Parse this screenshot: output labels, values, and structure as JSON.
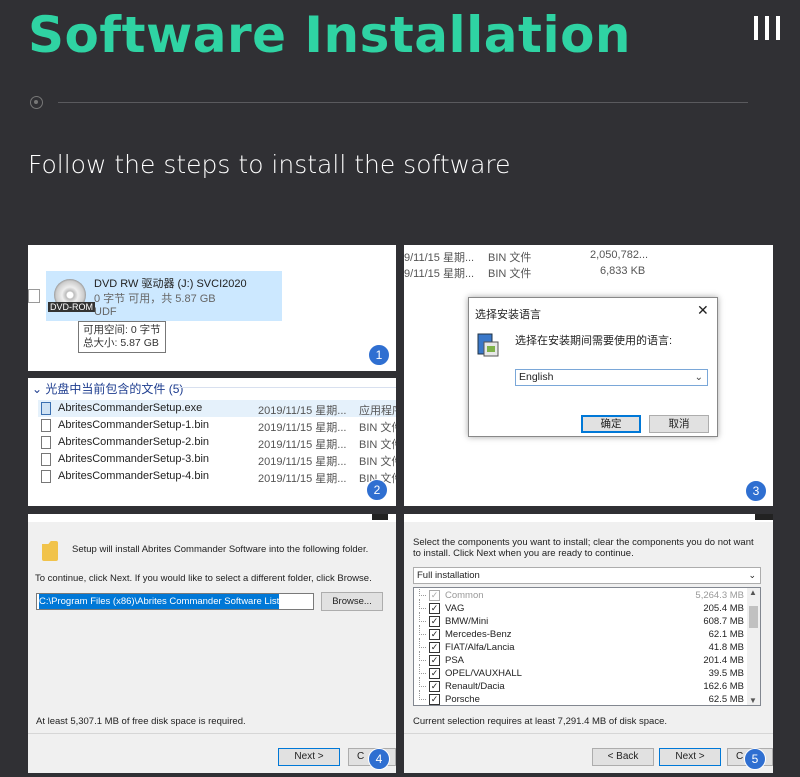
{
  "header": {
    "title": "Software Installation",
    "subtitle": "Follow the steps to install the software",
    "menu_icon": "hamburger-icon",
    "accent_color": "#2fd3a3"
  },
  "badges": [
    "1",
    "2",
    "3",
    "4",
    "5"
  ],
  "step1": {
    "drive_name": "DVD RW 驱动器 (J:) SVCI2020",
    "free_space": "0 字节 可用，共 5.87 GB",
    "filesystem": "UDF",
    "drive_tag": "DVD-ROM",
    "tooltip_free": "可用空间: 0 字节",
    "tooltip_total": "总大小: 5.87 GB"
  },
  "step2": {
    "group_header": "光盘中当前包含的文件 (5)",
    "files": [
      {
        "name": "AbritesCommanderSetup.exe",
        "date": "2019/11/15 星期...",
        "type": "应用程序"
      },
      {
        "name": "AbritesCommanderSetup-1.bin",
        "date": "2019/11/15 星期...",
        "type": "BIN 文件"
      },
      {
        "name": "AbritesCommanderSetup-2.bin",
        "date": "2019/11/15 星期...",
        "type": "BIN 文件"
      },
      {
        "name": "AbritesCommanderSetup-3.bin",
        "date": "2019/11/15 星期...",
        "type": "BIN 文件"
      },
      {
        "name": "AbritesCommanderSetup-4.bin",
        "date": "2019/11/15 星期...",
        "type": "BIN 文件"
      }
    ]
  },
  "step3": {
    "rows": [
      {
        "date": "9/11/15 星期...",
        "type": "BIN 文件",
        "size": "2,050,782..."
      },
      {
        "date": "9/11/15 星期...",
        "type": "BIN 文件",
        "size": "6,833 KB"
      }
    ],
    "dialog_title": "选择安装语言",
    "close": "✕",
    "message": "选择在安装期间需要使用的语言:",
    "language": "English",
    "ok": "确定",
    "cancel": "取消"
  },
  "step4": {
    "intro": "Setup will install Abrites Commander Software into the following folder.",
    "instruction": "To continue, click Next. If you would like to select a different folder, click Browse.",
    "path": "C:\\Program Files (x86)\\Abrites Commander Software List",
    "browse": "Browse...",
    "space_required": "At least 5,307.1 MB of free disk space is required.",
    "next": "Next >",
    "cancel": "C"
  },
  "step5": {
    "intro": "Select the components you want to install; clear the components you do not want to install. Click Next when you are ready to continue.",
    "install_type": "Full installation",
    "components": [
      {
        "name": "Common",
        "size": "5,264.3 MB",
        "disabled": true
      },
      {
        "name": "VAG",
        "size": "205.4 MB",
        "disabled": false
      },
      {
        "name": "BMW/Mini",
        "size": "608.7 MB",
        "disabled": false
      },
      {
        "name": "Mercedes-Benz",
        "size": "62.1 MB",
        "disabled": false
      },
      {
        "name": "FIAT/Alfa/Lancia",
        "size": "41.8 MB",
        "disabled": false
      },
      {
        "name": "PSA",
        "size": "201.4 MB",
        "disabled": false
      },
      {
        "name": "OPEL/VAUXHALL",
        "size": "39.5 MB",
        "disabled": false
      },
      {
        "name": "Renault/Dacia",
        "size": "162.6 MB",
        "disabled": false
      },
      {
        "name": "Porsche",
        "size": "62.5 MB",
        "disabled": false
      }
    ],
    "requirement": "Current selection requires at least 7,291.4 MB of disk space.",
    "back": "< Back",
    "next": "Next >",
    "cancel": "C"
  }
}
